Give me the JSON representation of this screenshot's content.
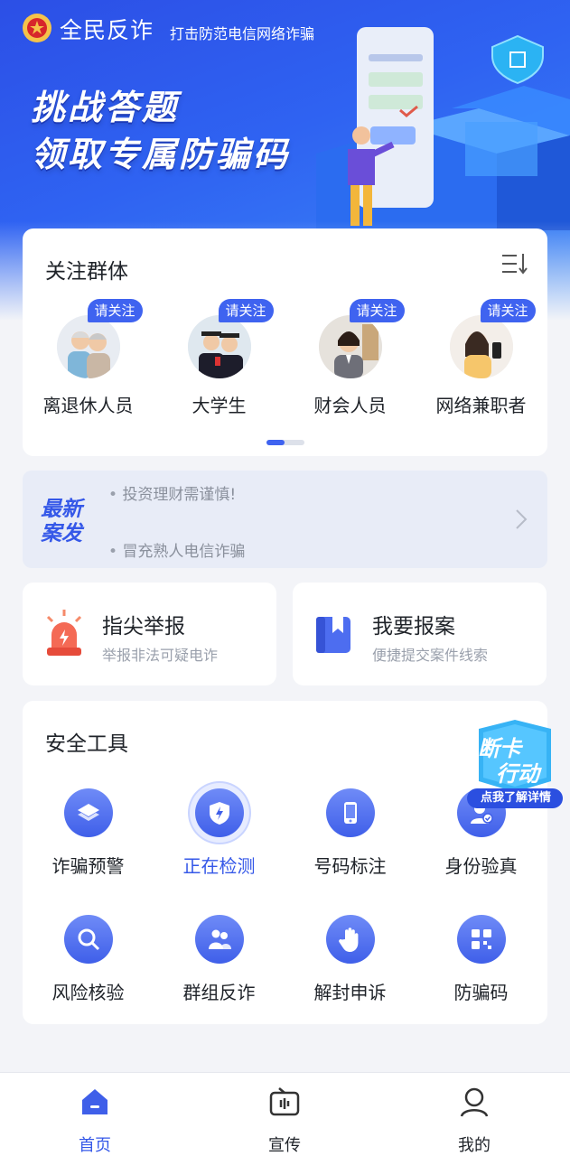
{
  "header": {
    "app_title": "全民反诈",
    "slogan": "打击防范电信网络诈骗",
    "headline_1": "挑战答题",
    "headline_2": "领取专属防骗码"
  },
  "groups": {
    "title": "关注群体",
    "follow_label": "请关注",
    "items": [
      {
        "label": "离退休人员",
        "icon": "elderly-couple-avatar"
      },
      {
        "label": "大学生",
        "icon": "graduates-avatar"
      },
      {
        "label": "财会人员",
        "icon": "accountant-avatar"
      },
      {
        "label": "网络兼职者",
        "icon": "part-timer-avatar"
      }
    ]
  },
  "news": {
    "badge": "最新案发",
    "items": [
      "投资理财需谨慎!",
      "冒充熟人电信诈骗"
    ]
  },
  "report": {
    "items": [
      {
        "title": "指尖举报",
        "subtitle": "举报非法可疑电诈",
        "icon": "siren-icon"
      },
      {
        "title": "我要报案",
        "subtitle": "便捷提交案件线索",
        "icon": "bookmark-book-icon"
      }
    ]
  },
  "tools": {
    "title": "安全工具",
    "items": [
      {
        "label": "诈骗预警",
        "icon": "layers-icon"
      },
      {
        "label": "正在检测",
        "icon": "shield-bolt-icon",
        "active": true
      },
      {
        "label": "号码标注",
        "icon": "phone-icon"
      },
      {
        "label": "身份验真",
        "icon": "id-verify-icon"
      },
      {
        "label": "风险核验",
        "icon": "search-icon"
      },
      {
        "label": "群组反诈",
        "icon": "group-icon"
      },
      {
        "label": "解封申诉",
        "icon": "hand-icon"
      },
      {
        "label": "防骗码",
        "icon": "qr-code-icon"
      }
    ]
  },
  "promo": {
    "title_1": "断卡",
    "title_2": "行动",
    "cta": "点我了解详情"
  },
  "bottom_nav": {
    "items": [
      {
        "label": "首页",
        "icon": "home-icon",
        "active": true
      },
      {
        "label": "宣传",
        "icon": "tv-icon"
      },
      {
        "label": "我的",
        "icon": "user-icon"
      }
    ]
  },
  "colors": {
    "primary": "#3f63f0",
    "banner_top": "#2c4fe6",
    "background": "#f3f4f8",
    "alert_red": "#f25a4b"
  }
}
